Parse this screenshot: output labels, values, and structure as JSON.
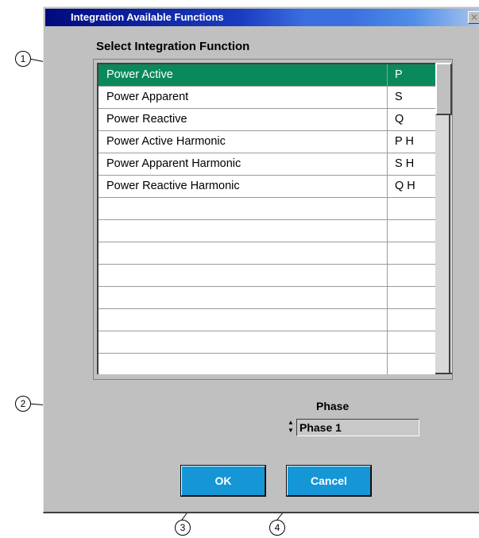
{
  "window": {
    "title": "Integration Available Functions",
    "close_glyph": "✕"
  },
  "list": {
    "heading": "Select Integration Function",
    "rows": [
      {
        "name": "Power Active",
        "code": "P",
        "selected": true
      },
      {
        "name": "Power Apparent",
        "code": "S",
        "selected": false
      },
      {
        "name": "Power Reactive",
        "code": "Q",
        "selected": false
      },
      {
        "name": "Power Active Harmonic",
        "code": "P H",
        "selected": false
      },
      {
        "name": "Power Apparent Harmonic",
        "code": "S H",
        "selected": false
      },
      {
        "name": "Power Reactive Harmonic",
        "code": "Q H",
        "selected": false
      },
      {
        "name": "",
        "code": ""
      },
      {
        "name": "",
        "code": ""
      },
      {
        "name": "",
        "code": ""
      },
      {
        "name": "",
        "code": ""
      },
      {
        "name": "",
        "code": ""
      },
      {
        "name": "",
        "code": ""
      },
      {
        "name": "",
        "code": ""
      },
      {
        "name": "",
        "code": ""
      }
    ],
    "selected_color": "#0a8a5a"
  },
  "phase": {
    "label": "Phase",
    "value": "Phase 1",
    "spinner_up": "▲",
    "spinner_down": "▼"
  },
  "buttons": {
    "ok_label": "OK",
    "cancel_label": "Cancel",
    "color": "#1596d6"
  },
  "callouts": [
    "1",
    "2",
    "3",
    "4"
  ]
}
